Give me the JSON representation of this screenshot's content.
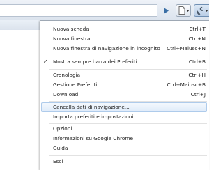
{
  "menu": {
    "items": [
      {
        "label": "Nuova scheda",
        "shortcut": "Ctrl+T"
      },
      {
        "label": "Nuova finestra",
        "shortcut": "Ctrl+N"
      },
      {
        "label": "Nuova finestra di navigazione in incognito",
        "shortcut": "Ctrl+Maiusc+N"
      },
      {
        "label": "Mostra sempre barra dei Preferiti",
        "shortcut": "Ctrl+B",
        "checked": true
      },
      {
        "label": "Cronologia",
        "shortcut": "Ctrl+H"
      },
      {
        "label": "Gestione Preferiti",
        "shortcut": "Ctrl+Maiusc+B"
      },
      {
        "label": "Download",
        "shortcut": "Ctrl+J"
      },
      {
        "label": "Cancella dati di navigazione...",
        "shortcut": "",
        "highlighted": true
      },
      {
        "label": "Importa preferiti e impostazioni...",
        "shortcut": ""
      },
      {
        "label": "Opzioni",
        "shortcut": ""
      },
      {
        "label": "Informazioni su Google Chrome",
        "shortcut": ""
      },
      {
        "label": "Guida",
        "shortcut": ""
      },
      {
        "label": "Esci",
        "shortcut": ""
      }
    ],
    "check_glyph": "✓"
  },
  "toolbar": {
    "icons": [
      "play-icon",
      "page-icon",
      "wrench-icon"
    ]
  },
  "colors": {
    "highlight_border": "#aecbeb",
    "highlight_fill": "#dfebf9",
    "separator": "#e2e2e2"
  }
}
